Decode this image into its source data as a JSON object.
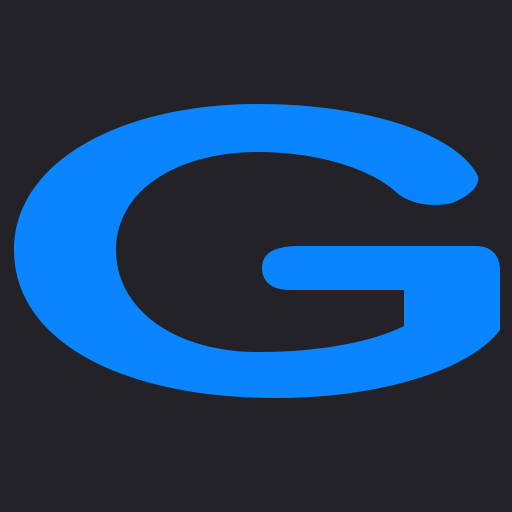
{
  "logo": {
    "letter": "G",
    "icon": "letter-g-logo-icon"
  },
  "colors": {
    "background": "#232228",
    "accent": "#0a84ff"
  }
}
